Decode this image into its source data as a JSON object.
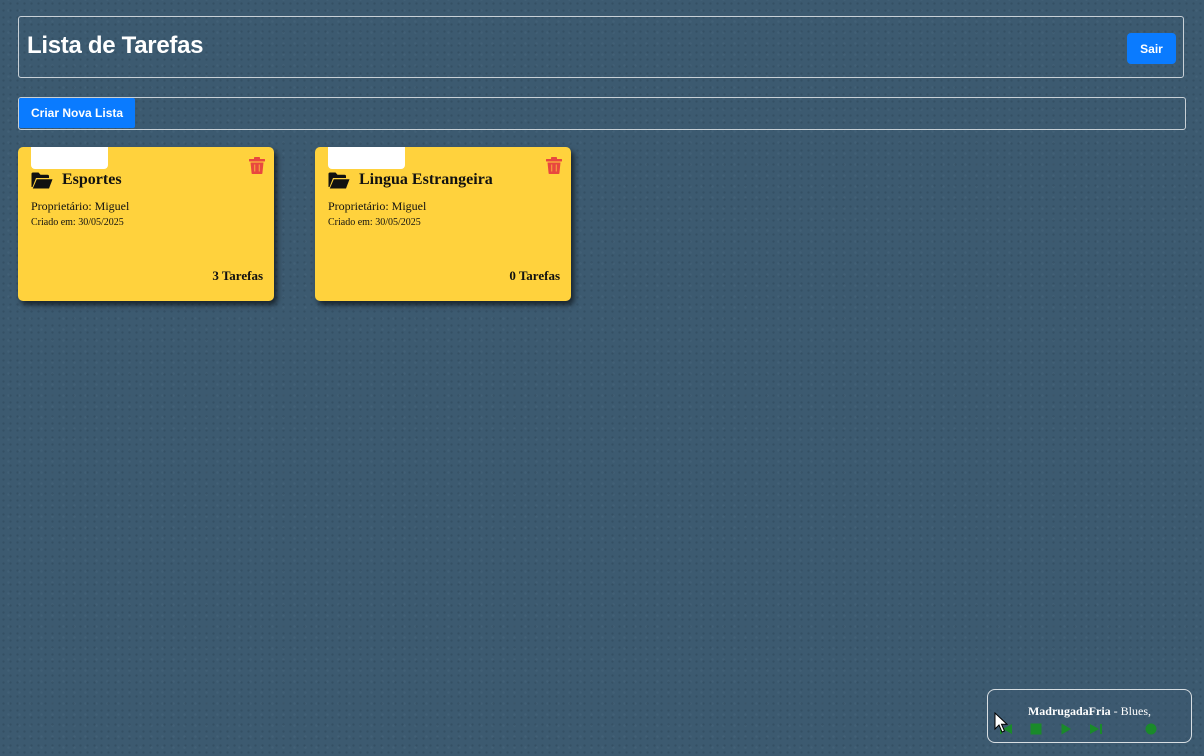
{
  "header": {
    "title": "Lista de Tarefas",
    "logout_label": "Sair"
  },
  "toolbar": {
    "create_list_label": "Criar Nova Lista"
  },
  "lists": [
    {
      "name": "Esportes",
      "owner": "Proprietário: Miguel",
      "created": "Criado em: 30/05/2025",
      "count": "3 Tarefas"
    },
    {
      "name": "Lingua Estrangeira",
      "owner": "Proprietário: Miguel",
      "created": "Criado em: 30/05/2025",
      "count": "0 Tarefas"
    }
  ],
  "player": {
    "title": "MadrugadaFria",
    "artist": "Blues,",
    "separator": " - "
  },
  "colors": {
    "background": "#3c5a70",
    "accent": "#0a7bff",
    "card": "#ffd23d",
    "delete": "#e8473f",
    "player_controls": "#1a8a2a"
  },
  "icons": {
    "folder": "folder-open-icon",
    "delete": "trash-icon",
    "player": [
      "previous-icon",
      "stop-icon",
      "play-icon",
      "next-icon",
      "record-icon"
    ]
  }
}
